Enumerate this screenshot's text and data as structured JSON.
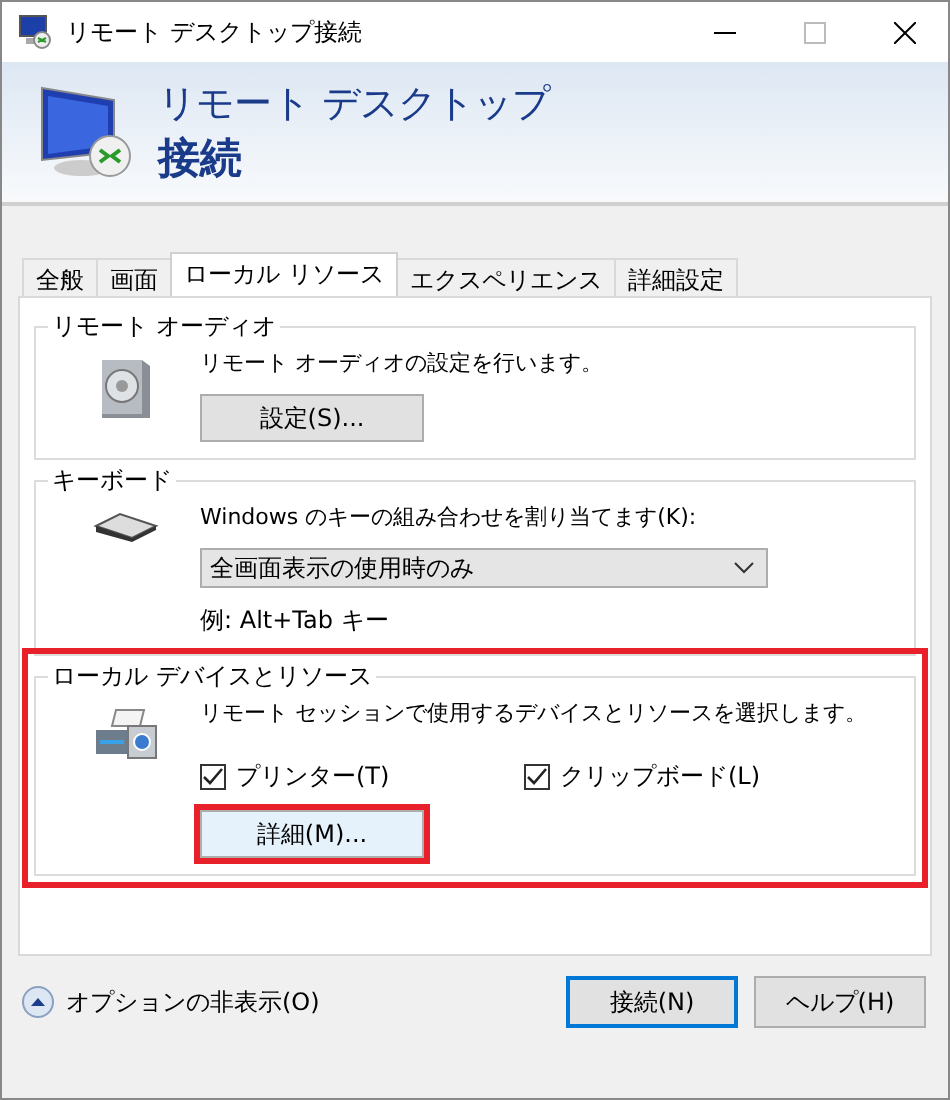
{
  "window": {
    "title": "リモート デスクトップ接続"
  },
  "header": {
    "line1": "リモート デスクトップ",
    "line2": "接続"
  },
  "tabs": [
    {
      "label": "全般",
      "selected": false
    },
    {
      "label": "画面",
      "selected": false
    },
    {
      "label": "ローカル リソース",
      "selected": true
    },
    {
      "label": "エクスペリエンス",
      "selected": false
    },
    {
      "label": "詳細設定",
      "selected": false
    }
  ],
  "groups": [
    {
      "kind": "audio",
      "title": "リモート オーディオ",
      "highlighted": false,
      "description": "リモート オーディオの設定を行います。",
      "button": {
        "label": "設定(S)...",
        "highlighted": false
      }
    },
    {
      "kind": "keyboard",
      "title": "キーボード",
      "highlighted": false,
      "description": "Windows のキーの組み合わせを割り当てます(K):",
      "dropdown": {
        "value": "全画面表示の使用時のみ"
      },
      "note": "例: Alt+Tab キー"
    },
    {
      "kind": "devices",
      "title": "ローカル デバイスとリソース",
      "highlighted": true,
      "description": "リモート セッションで使用するデバイスとリソースを選択します。",
      "checkboxes": [
        {
          "label": "プリンター(T)",
          "checked": true
        },
        {
          "label": "クリップボード(L)",
          "checked": true
        }
      ],
      "button": {
        "label": "詳細(M)...",
        "highlighted": true
      }
    }
  ],
  "footer": {
    "toggle": "オプションの非表示(O)",
    "buttons": [
      {
        "label": "接続(N)",
        "default": true
      },
      {
        "label": "ヘルプ(H)",
        "default": false
      }
    ]
  }
}
